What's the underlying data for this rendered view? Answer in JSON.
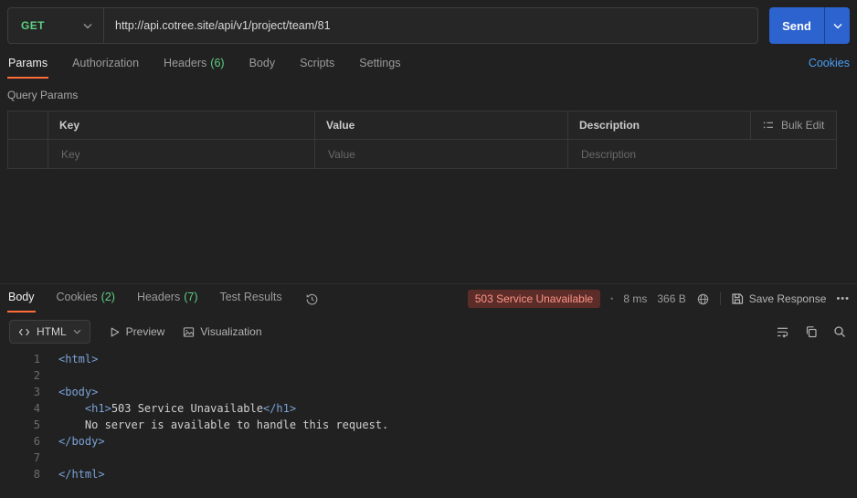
{
  "colors": {
    "method_green": "#5fce83",
    "count_green": "#5fce83",
    "send_blue": "#2c63cf",
    "link_blue": "#4a9df5",
    "accent_orange": "#ff6c37",
    "status_bg": "#5c2d28",
    "status_text": "#ff9488",
    "tag_blue": "#7aa2d8"
  },
  "request": {
    "method": "GET",
    "url": "http://api.cotree.site/api/v1/project/team/81",
    "send_label": "Send"
  },
  "request_tabs": [
    {
      "label": "Params"
    },
    {
      "label": "Authorization"
    },
    {
      "label": "Headers",
      "count": "(6)"
    },
    {
      "label": "Body"
    },
    {
      "label": "Scripts"
    },
    {
      "label": "Settings"
    }
  ],
  "cookies_link": "Cookies",
  "query_params": {
    "title": "Query Params",
    "columns": {
      "key": "Key",
      "value": "Value",
      "description": "Description"
    },
    "bulk_edit_label": "Bulk Edit",
    "placeholders": {
      "key": "Key",
      "value": "Value",
      "description": "Description"
    }
  },
  "response": {
    "tabs": [
      {
        "label": "Body"
      },
      {
        "label": "Cookies",
        "count": "(2)"
      },
      {
        "label": "Headers",
        "count": "(7)"
      },
      {
        "label": "Test Results"
      }
    ],
    "status": "503 Service Unavailable",
    "dot": "•",
    "time": "8 ms",
    "size": "366 B",
    "save_label": "Save Response",
    "more_label": "•••",
    "format": "HTML",
    "preview_label": "Preview",
    "visualization_label": "Visualization",
    "code": {
      "lines": [
        {
          "n": "1",
          "t": [
            [
              "tag",
              "<html>"
            ]
          ]
        },
        {
          "n": "2",
          "t": []
        },
        {
          "n": "3",
          "t": [
            [
              "tag",
              "<body>"
            ]
          ]
        },
        {
          "n": "4",
          "t": [
            [
              "pl",
              "    "
            ],
            [
              "tag",
              "<h1>"
            ],
            [
              "tx",
              "503 Service Unavailable"
            ],
            [
              "tag",
              "</h1>"
            ]
          ]
        },
        {
          "n": "5",
          "t": [
            [
              "pl",
              "    "
            ],
            [
              "tx",
              "No server is available to handle this request."
            ]
          ]
        },
        {
          "n": "6",
          "t": [
            [
              "tag",
              "</body>"
            ]
          ]
        },
        {
          "n": "7",
          "t": []
        },
        {
          "n": "8",
          "t": [
            [
              "tag",
              "</html>"
            ]
          ]
        }
      ]
    }
  }
}
